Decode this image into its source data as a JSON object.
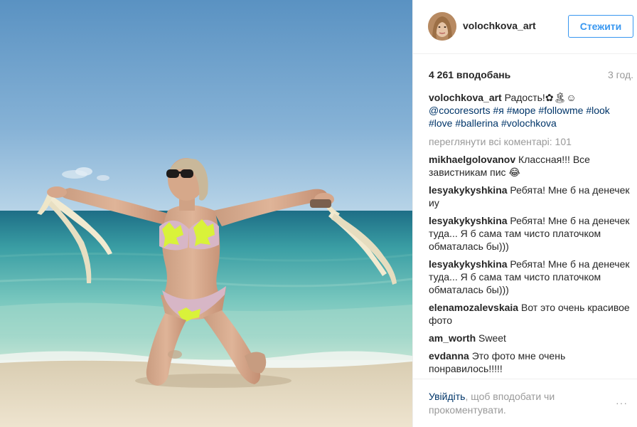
{
  "post": {
    "username": "volochkova_art",
    "follow_label": "Стежити",
    "likes": "4 261 вподобань",
    "time_ago": "3 год.",
    "caption": {
      "author": "volochkova_art",
      "text_start": " Радость!✿🏝☺ ",
      "tags": [
        "@cocoresorts",
        "#я",
        "#море",
        "#followme",
        "#look",
        "#love",
        "#ballerina",
        "#volochkova"
      ]
    },
    "more_comments": "переглянути всі коментарі: 101",
    "comments": [
      {
        "author": "mikhaelgolovanov",
        "text": "Классная!!! Все завистникам пис 😂"
      },
      {
        "author": "lesyakykyshkina",
        "text": "Ребята! Мне б на денечек иу"
      },
      {
        "author": "lesyakykyshkina",
        "text": "Ребята! Мне б на денечек туда... Я б сама там чисто платочком обматалась бы)))"
      },
      {
        "author": "lesyakykyshkina",
        "text": "Ребята! Мне б на денечек туда... Я б сама там чисто платочком обматалась бы)))"
      },
      {
        "author": "elenamozalevskaia",
        "text": "Вот это очень красивое фото"
      },
      {
        "author": "am_worth",
        "text": "Sweet"
      },
      {
        "author": "evdanna",
        "text": "Это фото мне очень понравилось!!!!!"
      }
    ],
    "footer": {
      "login_link": "Увійдіть",
      "rest": ", щоб вподобати чи прокоментувати.",
      "more_dots": "···"
    }
  },
  "colors": {
    "accent_blue": "#3897f0",
    "link_dark": "#003569",
    "muted": "#999999",
    "border": "#efefef"
  }
}
